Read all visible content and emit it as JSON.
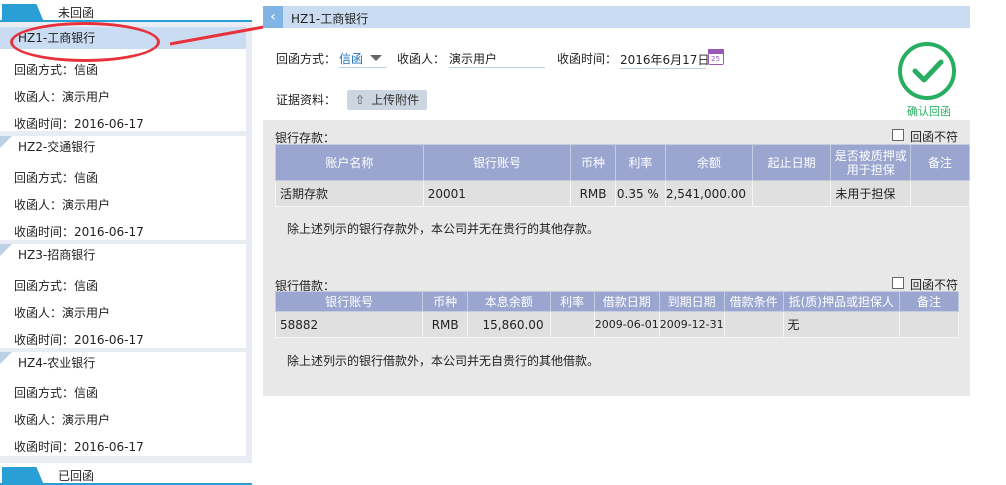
{
  "sidebar": {
    "pending_header": "未回函",
    "done_header": "已回函",
    "cards": [
      {
        "title": "HZ1-工商银行",
        "method": "回函方式：信函",
        "receiver": "收函人：演示用户",
        "time": "收函时间：2016-06-17",
        "selected": true
      },
      {
        "title": "HZ2-交通银行",
        "method": "回函方式：信函",
        "receiver": "收函人：演示用户",
        "time": "收函时间：2016-06-17"
      },
      {
        "title": "HZ3-招商银行",
        "method": "回函方式：信函",
        "receiver": "收函人：演示用户",
        "time": "收函时间：2016-06-17"
      },
      {
        "title": "HZ4-农业银行",
        "method": "回函方式：信函",
        "receiver": "收函人：演示用户",
        "time": "收函时间：2016-06-17"
      }
    ]
  },
  "header": {
    "back_icon": "chevron-left-icon",
    "title": "HZ1-工商银行"
  },
  "form": {
    "method_label": "回函方式：",
    "method_value": "信函",
    "receiver_label": "收函人：",
    "receiver_value": "演示用户",
    "time_label": "收函时间：",
    "time_value": "2016年6月17日",
    "calendar_day": "25",
    "evidence_label": "证据资料：",
    "upload_label": "上传附件"
  },
  "confirm": {
    "label": "确认回函",
    "color": "#27ae60"
  },
  "deposits": {
    "section_label": "银行存款：",
    "mismatch_label": "回函不符",
    "columns": [
      "账户名称",
      "银行账号",
      "币种",
      "利率",
      "余额",
      "起止日期",
      "是否被质押或用于担保",
      "备注"
    ],
    "rows": [
      [
        "活期存款",
        "20001",
        "RMB",
        "0.35 %",
        "2,541,000.00",
        "",
        "未用于担保",
        ""
      ]
    ],
    "note": "除上述列示的银行存款外，本公司并无在贵行的其他存款。"
  },
  "loans": {
    "section_label": "银行借款：",
    "mismatch_label": "回函不符",
    "columns": [
      "银行账号",
      "币种",
      "本息余额",
      "利率",
      "借款日期",
      "到期日期",
      "借款条件",
      "抵(质)押品或担保人",
      "备注"
    ],
    "rows": [
      [
        "58882",
        "RMB",
        "15,860.00",
        "",
        "2009-06-01",
        "2009-12-31",
        "",
        "无",
        ""
      ]
    ],
    "note": "除上述列示的银行借款外，本公司并无自贵行的其他借款。"
  },
  "colors": {
    "accent": "#2a9fd6",
    "table_header": "#9aa6cf",
    "annotation": "#e8313b"
  }
}
